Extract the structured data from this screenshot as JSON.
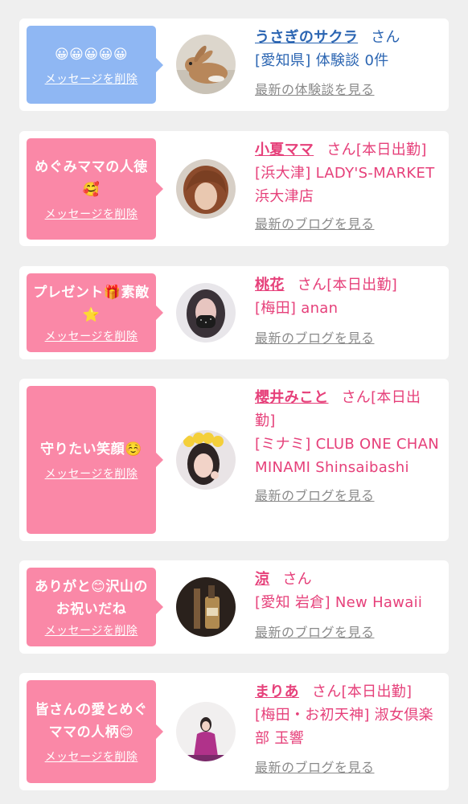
{
  "cards": [
    {
      "message": "😀😀😀😀😀",
      "delete_label": "メッセージを削除",
      "name": "うさぎのサクラ",
      "honorific": "さん",
      "status": "",
      "shop": "[愛知県] 体験談 0件",
      "link_label": "最新の体験談を見る",
      "theme": "blue",
      "avatar": "rabbit-avatar"
    },
    {
      "message": "めぐみママの人徳🥰",
      "delete_label": "メッセージを削除",
      "name": "小夏ママ",
      "honorific": "さん",
      "status": "[本日出勤]",
      "shop": "[浜大津] LADY'S-MARKET 浜大津店",
      "link_label": "最新のブログを見る",
      "theme": "pink",
      "avatar": "woman-avatar"
    },
    {
      "message": "プレゼント🎁素敵⭐",
      "delete_label": "メッセージを削除",
      "name": "桃花",
      "honorific": "さん",
      "status": "[本日出勤]",
      "shop": "[梅田] anan",
      "link_label": "最新のブログを見る",
      "theme": "pink",
      "avatar": "woman-avatar"
    },
    {
      "message": "守りたい笑顔☺️",
      "delete_label": "メッセージを削除",
      "name": "櫻井みこと",
      "honorific": "さん",
      "status": "[本日出勤]",
      "shop": "[ミナミ] CLUB ONE CHAN MINAMI Shinsaibashi",
      "link_label": "最新のブログを見る",
      "theme": "pink",
      "avatar": "woman-avatar"
    },
    {
      "message": "ありがと😊沢山のお祝いだね",
      "delete_label": "メッセージを削除",
      "name": "涼",
      "honorific": "さん",
      "status": "",
      "shop": "[愛知 岩倉] New Hawaii",
      "link_label": "最新のブログを見る",
      "theme": "pink",
      "avatar": "bottle-avatar"
    },
    {
      "message": "皆さんの愛とめぐママの人柄😊",
      "delete_label": "メッセージを削除",
      "name": "まりあ",
      "honorific": "さん",
      "status": "[本日出勤]",
      "shop": "[梅田・お初天神] 淑女倶楽部 玉響",
      "link_label": "最新のブログを見る",
      "theme": "pink",
      "avatar": "woman-avatar"
    }
  ]
}
